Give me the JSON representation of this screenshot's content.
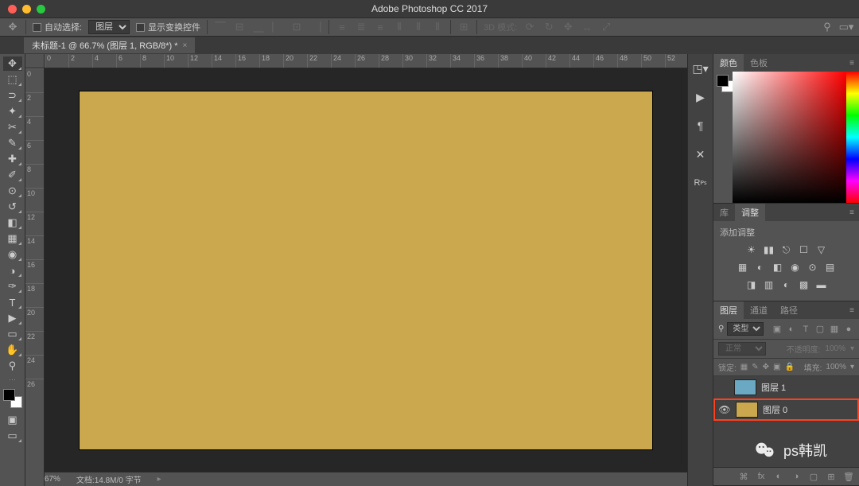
{
  "title": "Adobe Photoshop CC 2017",
  "optionsbar": {
    "auto_select_label": "自动选择:",
    "auto_select_value": "图层",
    "show_transform_label": "显示变换控件",
    "mode_3d_label": "3D 模式:"
  },
  "document_tab": "未标题-1 @ 66.7% (图层 1, RGB/8*) *",
  "ruler_h": [
    "0",
    "2",
    "4",
    "6",
    "8",
    "10",
    "12",
    "14",
    "16",
    "18",
    "20",
    "22",
    "24",
    "26",
    "28",
    "30",
    "32",
    "34",
    "36",
    "38",
    "40",
    "42",
    "44",
    "46",
    "48",
    "50",
    "52"
  ],
  "ruler_v": [
    "0",
    "2",
    "4",
    "6",
    "8",
    "10",
    "12",
    "14",
    "16",
    "18",
    "20",
    "22",
    "24",
    "26"
  ],
  "canvas_color": "#cba74e",
  "statusbar": {
    "zoom": "66.67%",
    "info": "文档:14.8M/0 字节"
  },
  "panels": {
    "color_tab": "颜色",
    "swatches_tab": "色板",
    "libraries_tab": "库",
    "adjustments_tab": "调整",
    "add_adjustment_label": "添加调整",
    "layers_tab": "图层",
    "channels_tab": "通道",
    "paths_tab": "路径",
    "layer_filter": "类型",
    "blend_mode": "正常",
    "opacity_label": "不透明度:",
    "opacity_value": "100%",
    "lock_label": "锁定:",
    "fill_label": "填充:",
    "fill_value": "100%",
    "layers": [
      {
        "name": "图层 1",
        "visible": false,
        "color": "#6aa8c4",
        "highlighted": false
      },
      {
        "name": "图层 0",
        "visible": true,
        "color": "#cba74e",
        "highlighted": true
      }
    ]
  },
  "watermark": "ps韩凯"
}
